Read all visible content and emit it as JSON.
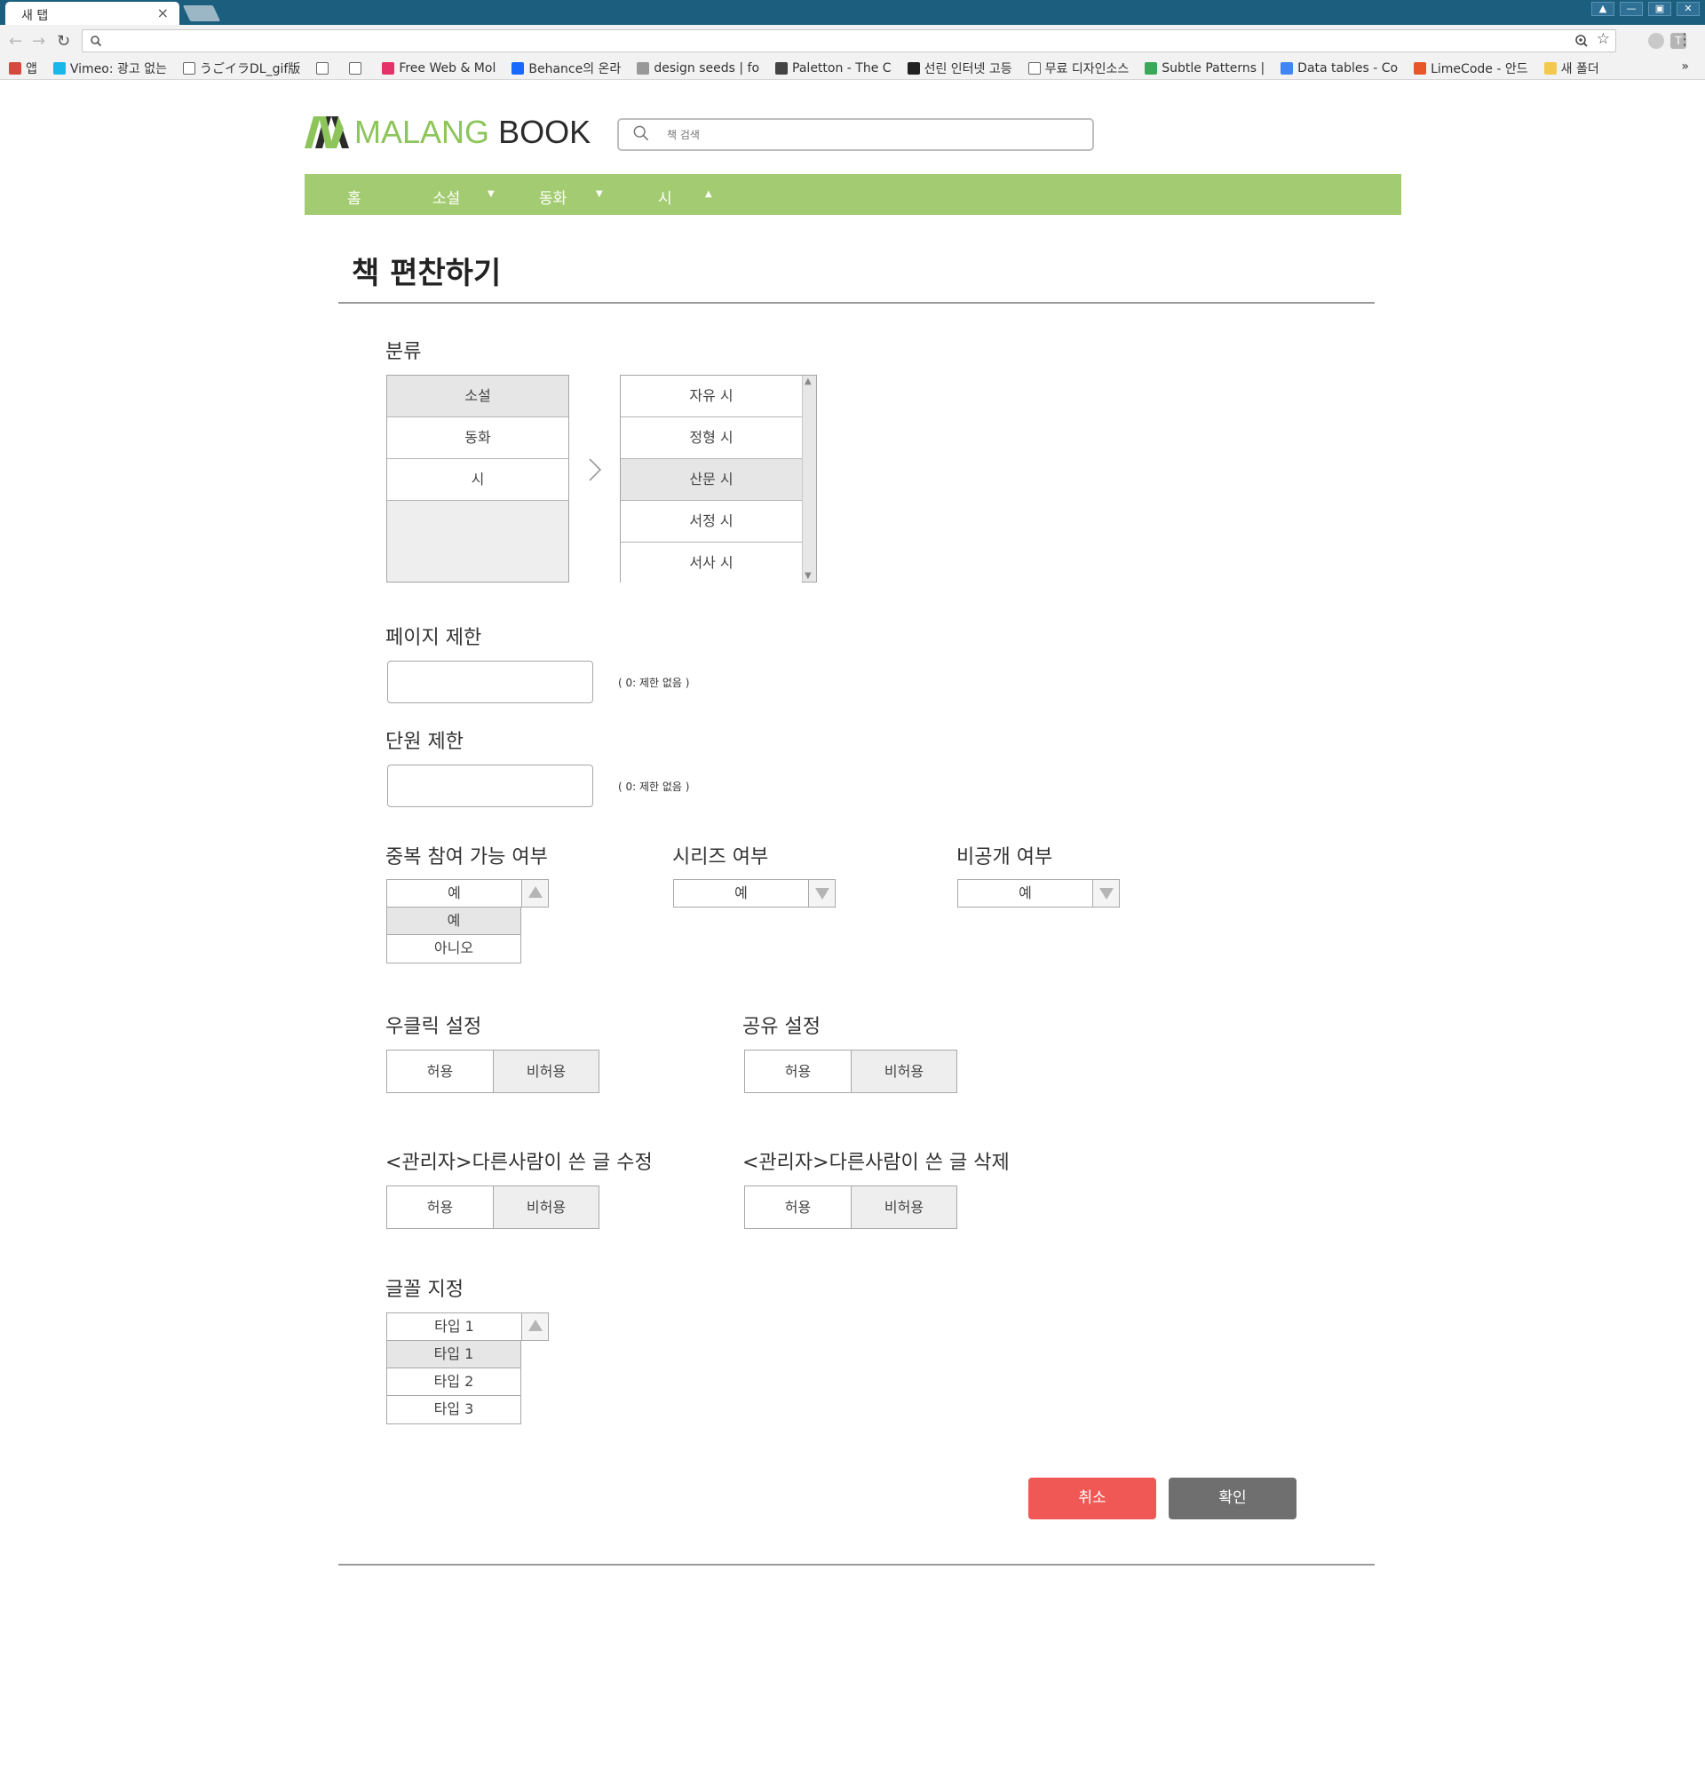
{
  "browser": {
    "tab_title": "새 탭",
    "tab_close": "×",
    "window_buttons": [
      "▲",
      "—",
      "▣",
      "✕"
    ],
    "ext_t_label": "T",
    "bookmarks": [
      {
        "label": "앱",
        "icon": "apps-grid-icon",
        "color": "#d24b3e"
      },
      {
        "label": "Vimeo: 광고 없는",
        "icon": "vimeo-icon",
        "color": "#1ab7ea"
      },
      {
        "label": "うごイラDL_gif版",
        "icon": "page-icon",
        "color": "#ffffff"
      },
      {
        "label": "",
        "icon": "page-icon",
        "color": "#ffffff"
      },
      {
        "label": "",
        "icon": "page-icon",
        "color": "#ffffff"
      },
      {
        "label": "Free Web & Mol",
        "icon": "invision-icon",
        "color": "#e5326a"
      },
      {
        "label": "Behance의 온라",
        "icon": "behance-icon",
        "color": "#1769ff"
      },
      {
        "label": "design seeds | fo",
        "icon": "designseeds-icon",
        "color": "#999999"
      },
      {
        "label": "Paletton - The C",
        "icon": "paletton-icon",
        "color": "#444444"
      },
      {
        "label": "선린 인터넷 고등",
        "icon": "sunrin-icon",
        "color": "#222222"
      },
      {
        "label": "무료 디자인소스",
        "icon": "page-icon",
        "color": "#ffffff"
      },
      {
        "label": "Subtle Patterns |",
        "icon": "subtlepatterns-icon",
        "color": "#3aa85a"
      },
      {
        "label": "Data tables - Co",
        "icon": "google-icon",
        "color": "#4285f4"
      },
      {
        "label": "LimeCode - 안드",
        "icon": "limecode-icon",
        "color": "#e8572a"
      },
      {
        "label": "새 폴더",
        "icon": "folder-icon",
        "color": "#f2c94c"
      }
    ],
    "more_label": "»"
  },
  "header": {
    "logo_malang": "MALANG",
    "logo_book": "BOOK",
    "search_placeholder": "책 검색",
    "brand_color": "#8dc55a"
  },
  "nav": {
    "items": [
      {
        "label": "홈",
        "caret": ""
      },
      {
        "label": "소설",
        "caret": "▼"
      },
      {
        "label": "동화",
        "caret": "▼"
      },
      {
        "label": "시",
        "caret": "▲"
      }
    ],
    "bg_color": "#a3cc72"
  },
  "page": {
    "title": "책 편찬하기"
  },
  "category": {
    "label": "분류",
    "main_items": [
      "소설",
      "동화",
      "시"
    ],
    "main_selected": "소설",
    "sub_items": [
      "자유 시",
      "정형 시",
      "산문 시",
      "서정 시",
      "서사 시"
    ],
    "sub_selected": "산문 시"
  },
  "page_limit": {
    "label": "페이지 제한",
    "value": "",
    "hint": "( 0: 제한 없음 )"
  },
  "unit_limit": {
    "label": "단원 제한",
    "value": "",
    "hint": "( 0: 제한 없음 )"
  },
  "dup_participation": {
    "label": "중복 참여 가능 여부",
    "value": "예",
    "options": [
      "예",
      "아니오"
    ],
    "highlighted": "예"
  },
  "series": {
    "label": "시리즈 여부",
    "value": "예"
  },
  "private": {
    "label": "비공개 여부",
    "value": "예"
  },
  "woo_click": {
    "label": "우클릭 설정",
    "allow": "허용",
    "deny": "비허용",
    "selected": "비허용"
  },
  "share": {
    "label": "공유 설정",
    "allow": "허용",
    "deny": "비허용",
    "selected": "비허용"
  },
  "admin_edit": {
    "label": "<관리자>다른사람이 쓴 글 수정",
    "allow": "허용",
    "deny": "비허용",
    "selected": "비허용"
  },
  "admin_delete": {
    "label": "<관리자>다른사람이 쓴 글 삭제",
    "allow": "허용",
    "deny": "비허용",
    "selected": "비허용"
  },
  "font": {
    "label": "글꼴 지정",
    "value": "타입 1",
    "options": [
      "타입 1",
      "타입 2",
      "타입 3"
    ],
    "highlighted": "타입 1"
  },
  "actions": {
    "cancel": "취소",
    "confirm": "확인",
    "cancel_color": "#ef5854",
    "confirm_color": "#6f6f6f"
  }
}
